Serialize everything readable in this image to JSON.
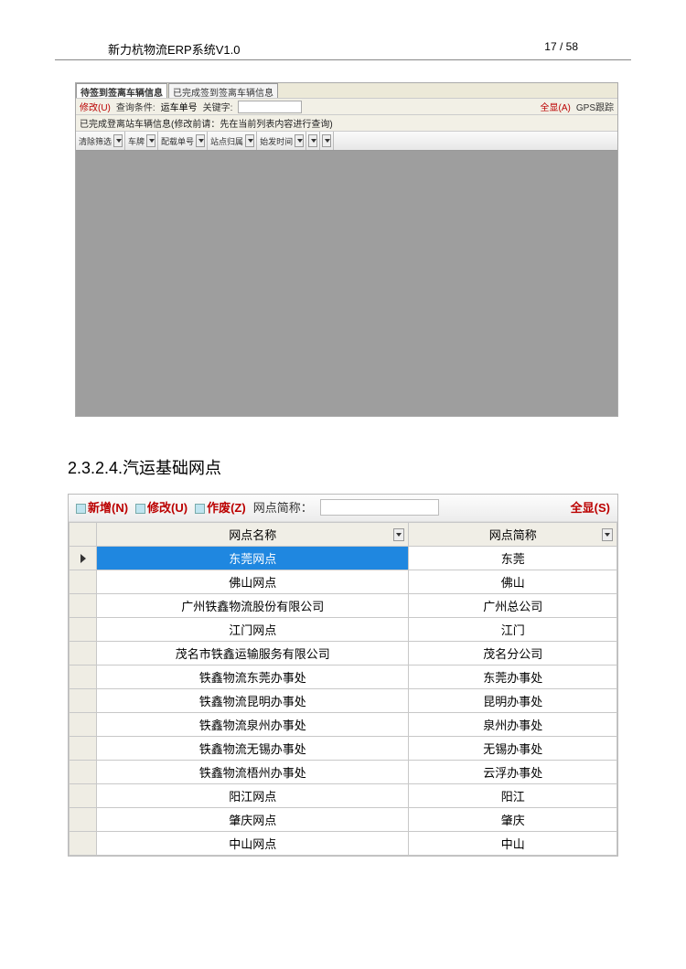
{
  "doc": {
    "title": "新力杭物流ERP系统V1.0",
    "page": "17 / 58"
  },
  "erp": {
    "tabs": {
      "t1": "待签到签离车辆信息",
      "t2": "已完成签到签离车辆信息"
    },
    "toolbar1": {
      "modify": "修改(U)",
      "query": "查询条件:",
      "queryval": "运车单号",
      "kwlabel": "关键字:",
      "all": "全显(A)",
      "gps": "GPS跟踪"
    },
    "info": "已完成登离站车辆信息(修改前请：先在当前列表内容进行查询)",
    "tb2": {
      "g1": "清除筛选",
      "g2": "车牌",
      "g3": "配载单号",
      "g4": "站点归属",
      "g5": "始发时间",
      "g6": ""
    }
  },
  "section": "2.3.2.4.汽运基础网点",
  "panel": {
    "add": "新增(N)",
    "modify": "修改(U)",
    "void": "作废(Z)",
    "net_label": "网点简称：",
    "all": "全显(S)",
    "col1": "网点名称",
    "col2": "网点简称",
    "rows": [
      {
        "name": "东莞网点",
        "short": "东莞"
      },
      {
        "name": "佛山网点",
        "short": "佛山"
      },
      {
        "name": "广州铁鑫物流股份有限公司",
        "short": "广州总公司"
      },
      {
        "name": "江门网点",
        "short": "江门"
      },
      {
        "name": "茂名市铁鑫运输服务有限公司",
        "short": "茂名分公司"
      },
      {
        "name": "铁鑫物流东莞办事处",
        "short": "东莞办事处"
      },
      {
        "name": "铁鑫物流昆明办事处",
        "short": "昆明办事处"
      },
      {
        "name": "铁鑫物流泉州办事处",
        "short": "泉州办事处"
      },
      {
        "name": "铁鑫物流无锡办事处",
        "short": "无锡办事处"
      },
      {
        "name": "铁鑫物流梧州办事处",
        "short": "云浮办事处"
      },
      {
        "name": "阳江网点",
        "short": "阳江"
      },
      {
        "name": "肇庆网点",
        "short": "肇庆"
      },
      {
        "name": "中山网点",
        "short": "中山"
      }
    ]
  }
}
